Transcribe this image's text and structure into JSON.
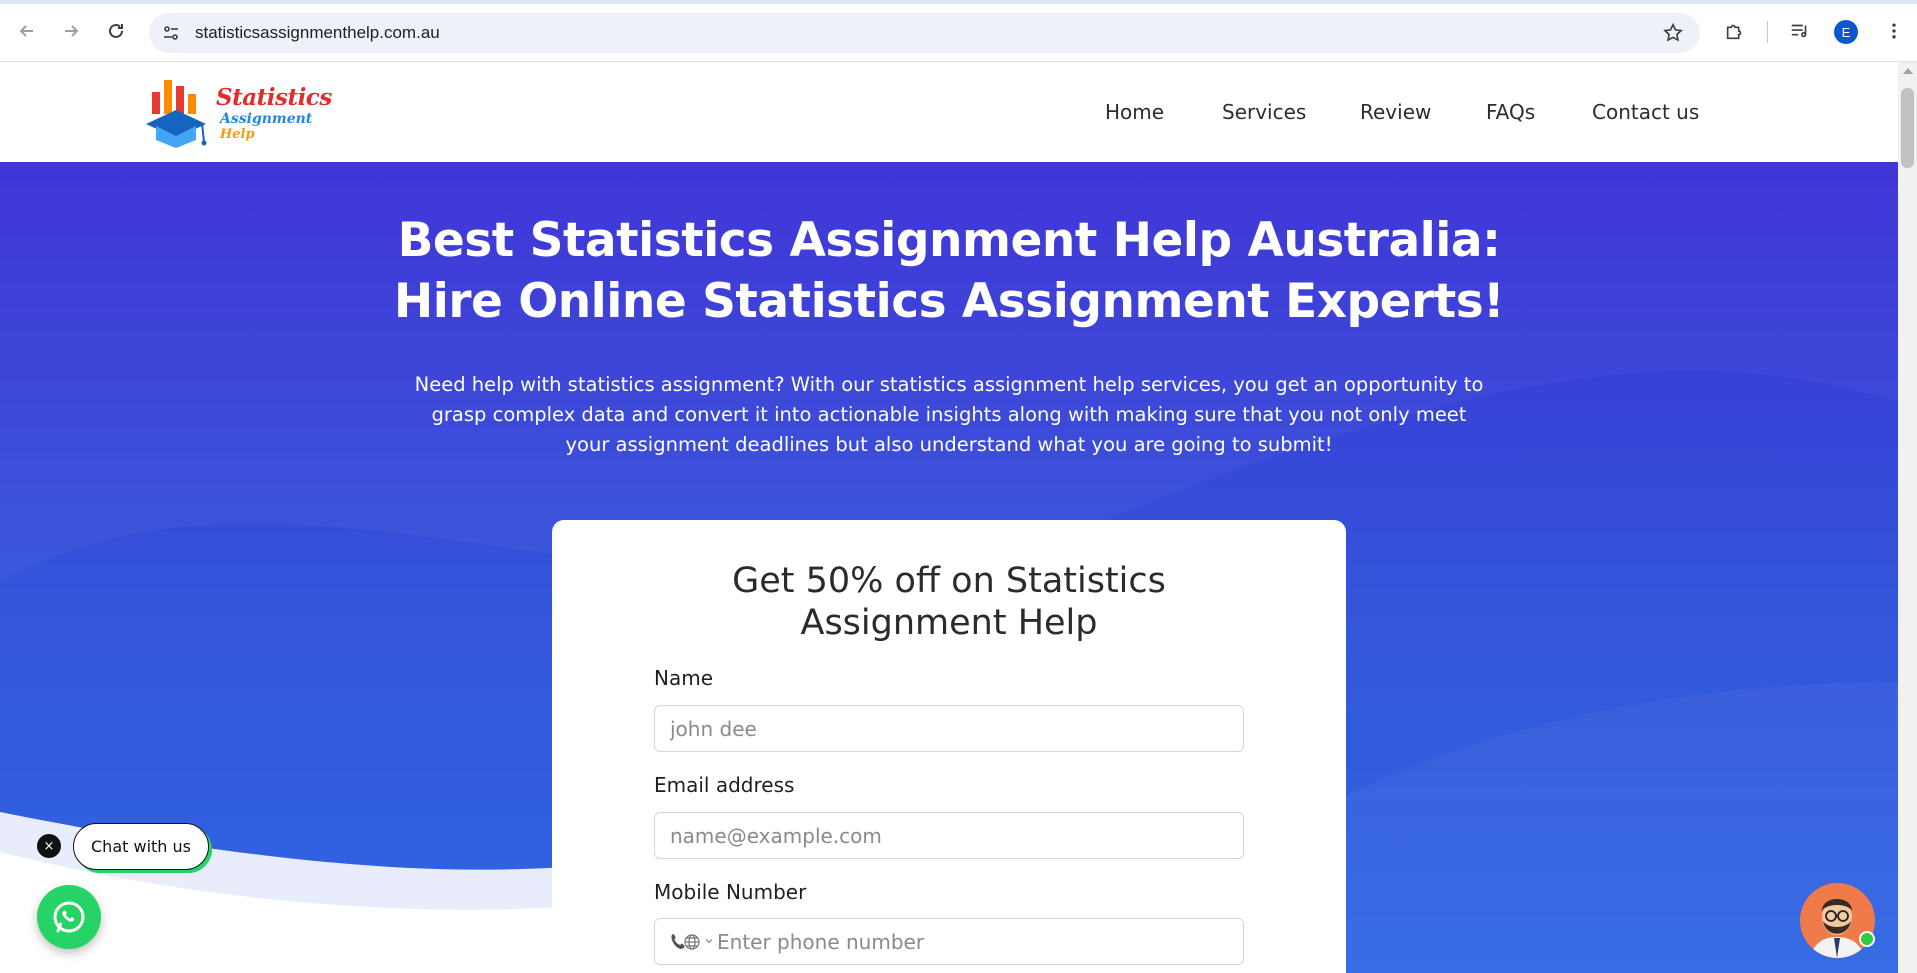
{
  "browser": {
    "url": "statisticsassignmenthelp.com.au",
    "profile_initial": "E"
  },
  "header": {
    "logo": {
      "line1": "Statistics",
      "line2": "Assignment",
      "line3": "Help"
    },
    "menu": [
      "Home",
      "Services",
      "Review",
      "FAQs",
      "Contact us"
    ]
  },
  "hero": {
    "title_line1": "Best Statistics Assignment Help Australia:",
    "title_line2": "Hire Online Statistics Assignment Experts!",
    "subtitle": "Need help with statistics assignment? With our statistics assignment help services, you get an opportunity to grasp complex data and convert it into actionable insights along with making sure that you not only meet your assignment deadlines but also understand what you are going to submit!"
  },
  "form": {
    "title_line1": "Get 50% off on Statistics",
    "title_line2": "Assignment Help",
    "name_label": "Name",
    "name_placeholder": "john dee",
    "email_label": "Email address",
    "email_placeholder": "name@example.com",
    "mobile_label": "Mobile Number",
    "mobile_placeholder": "Enter phone number"
  },
  "chat": {
    "close_symbol": "×",
    "pill_label": "Chat with us"
  },
  "colors": {
    "hero_top": "#3a2fd6",
    "hero_bottom": "#2f66e3",
    "whatsapp": "#25d366",
    "logo_red": "#e32d2d",
    "logo_blue": "#1e88e5",
    "logo_orange": "#f39c12"
  }
}
